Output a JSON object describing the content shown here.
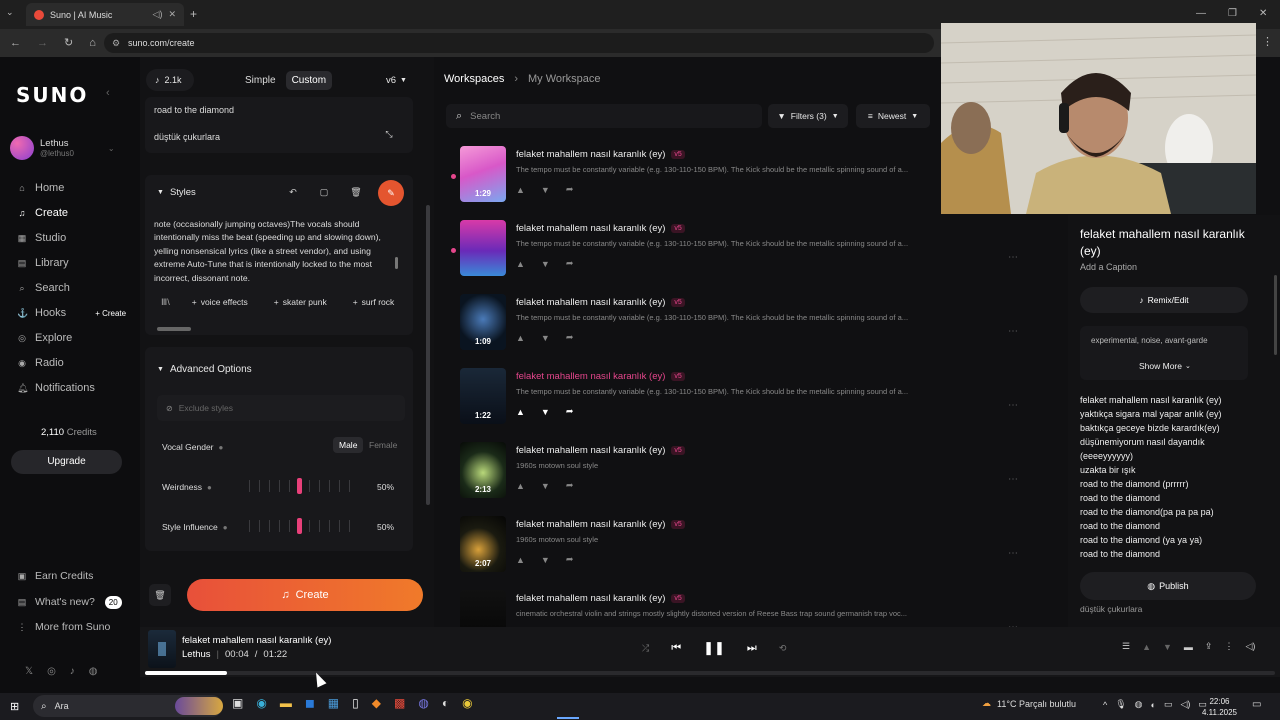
{
  "browser": {
    "tab_title": "Suno | AI Music",
    "url": "suno.com/create"
  },
  "nav": {
    "logo": "SUNO",
    "user_name": "Lethus",
    "user_handle": "@lethus0",
    "items": [
      {
        "label": "Home",
        "icon": "home-icon"
      },
      {
        "label": "Create",
        "icon": "create-icon"
      },
      {
        "label": "Studio",
        "icon": "studio-icon"
      },
      {
        "label": "Library",
        "icon": "library-icon"
      },
      {
        "label": "Search",
        "icon": "search-icon"
      },
      {
        "label": "Hooks",
        "icon": "hooks-icon"
      },
      {
        "label": "Explore",
        "icon": "explore-icon"
      },
      {
        "label": "Radio",
        "icon": "radio-icon"
      },
      {
        "label": "Notifications",
        "icon": "bell-icon"
      }
    ],
    "hooks_create": "+ Create",
    "credits_value": "2,110",
    "credits_label": "Credits",
    "upgrade": "Upgrade",
    "earn_credits": "Earn Credits",
    "whats_new": "What's new?",
    "whats_new_badge": "20",
    "more_from_suno": "More from Suno"
  },
  "panel": {
    "count": "2.1k",
    "mode_simple": "Simple",
    "mode_custom": "Custom",
    "version": "v6",
    "lyrics_lines": [
      "road to the diamond",
      "düştük çukurlara"
    ],
    "styles_label": "Styles",
    "styles_text": "note (occasionally jumping octaves)The vocals should intentionally miss the beat (speeding up and slowing down), yelling nonsensical lyrics (like a street vendor), and using extreme Auto-Tune that is intentionally locked to the most incorrect, dissonant note.",
    "tags": [
      "voice effects",
      "skater punk",
      "surf rock"
    ],
    "advanced_label": "Advanced Options",
    "exclude_placeholder": "Exclude styles",
    "vocal_gender_label": "Vocal Gender",
    "gender_male": "Male",
    "gender_female": "Female",
    "weirdness_label": "Weirdness",
    "weirdness_value": "50%",
    "weirdness_level": 0.5,
    "style_influence_label": "Style Influence",
    "style_influence_value": "50%",
    "style_influence_level": 0.5,
    "create_button": "Create"
  },
  "workspace": {
    "breadcrumb_root": "Workspaces",
    "breadcrumb_current": "My Workspace",
    "search_placeholder": "Search",
    "filters": "Filters (3)",
    "sort": "Newest",
    "songs": [
      {
        "title": "felaket mahallem nasıl karanlık (ey)",
        "version": "v5",
        "desc": "The tempo must be constantly variable (e.g. 130-110-150 BPM). The Kick should be the metallic spinning sound of a...",
        "length": "1:29"
      },
      {
        "title": "felaket mahallem nasıl karanlık (ey)",
        "version": "v5",
        "desc": "The tempo must be constantly variable (e.g. 130-110-150 BPM). The Kick should be the metallic spinning sound of a...",
        "length": ""
      },
      {
        "title": "felaket mahallem nasıl karanlık (ey)",
        "version": "v5",
        "desc": "The tempo must be constantly variable (e.g. 130-110-150 BPM). The Kick should be the metallic spinning sound of a...",
        "length": "1:09"
      },
      {
        "title": "felaket mahallem nasıl karanlık (ey)",
        "version": "v5",
        "desc": "The tempo must be constantly variable (e.g. 130-110-150 BPM). The Kick should be the metallic spinning sound of a...",
        "length": "1:22"
      },
      {
        "title": "felaket mahallem nasıl karanlık (ey)",
        "version": "v5",
        "desc": "1960s motown soul style",
        "length": "2:13"
      },
      {
        "title": "felaket mahallem nasıl karanlık (ey)",
        "version": "v5",
        "desc": "1960s motown soul style",
        "length": "2:07"
      },
      {
        "title": "felaket mahallem nasıl karanlık (ey)",
        "version": "v5",
        "desc": "cinematic orchestral violin and strings mostly slightly distorted version of Reese Bass trap sound germanish trap voc...",
        "length": ""
      }
    ]
  },
  "right_panel": {
    "title": "felaket mahallem nasıl karanlık (ey)",
    "caption": "Add a Caption",
    "remix": "Remix/Edit",
    "tags": "experimental, noise, avant-garde",
    "show_more": "Show More",
    "lyrics": [
      "felaket mahallem nasıl karanlık (ey)",
      "yaktıkça sigara mal yapar anlık (ey)",
      "baktıkça geceye bizde karardık(ey)",
      "düşünemiyorum nasıl dayandık",
      "(eeeeyyyyyy)",
      "uzakta bir ışık",
      "road to the diamond (prrrrr)",
      "road to the diamond",
      "road to the diamond(pa pa pa pa)",
      "road to the diamond",
      "road to the diamond (ya ya ya)",
      "road to the diamond"
    ],
    "publish": "Publish",
    "bottom_text": "düştük çukurlara"
  },
  "player": {
    "title": "felaket mahallem nasıl karanlık (ey)",
    "artist": "Lethus",
    "current_time": "00:04",
    "total_time": "01:22",
    "progress": 0.05
  },
  "taskbar": {
    "search": "Ara",
    "weather": "11°C  Parçalı bulutlu",
    "time": "22:06",
    "date": "4.11.2025"
  },
  "colors": {
    "accent": "#e8407a",
    "create_gradient_start": "#e8503a",
    "create_gradient_end": "#f07a2a"
  }
}
